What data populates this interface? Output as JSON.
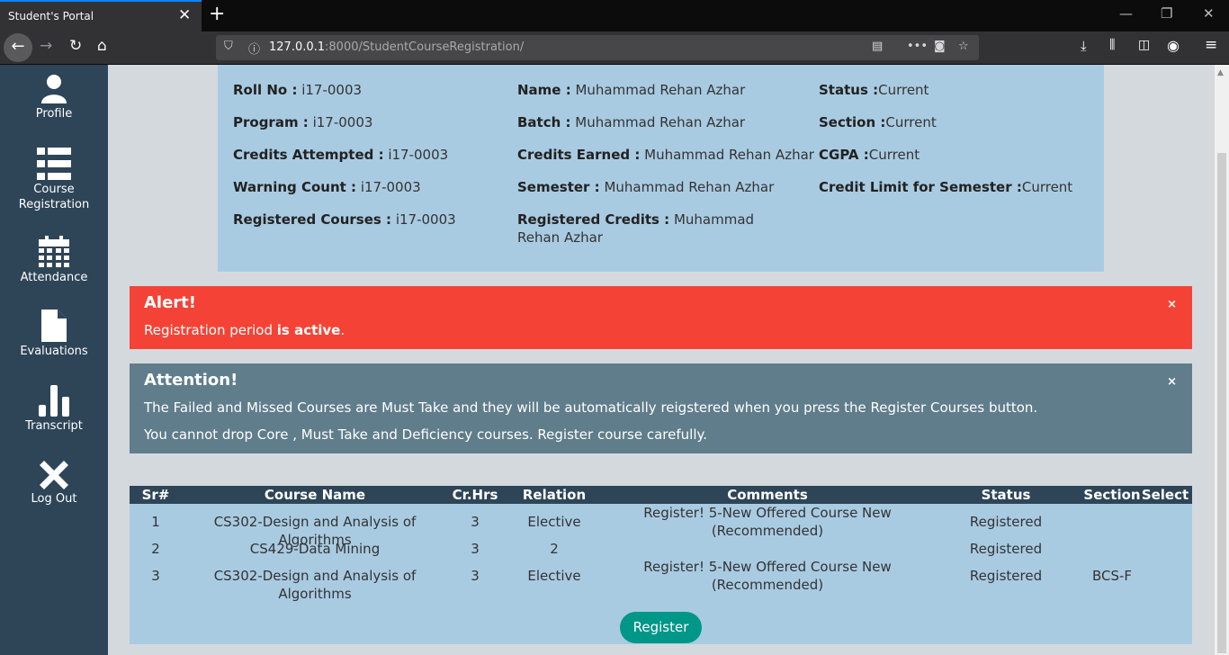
{
  "browser": {
    "tab_title": "Student's Portal",
    "url_host": "127.0.0.1",
    "url_rest": ":8000/StudentCourseRegistration/"
  },
  "sidebar": {
    "items": [
      {
        "label": "Profile"
      },
      {
        "label": "Course Registration"
      },
      {
        "label": "Attendance"
      },
      {
        "label": "Evaluations"
      },
      {
        "label": "Transcript"
      },
      {
        "label": "Log Out"
      }
    ]
  },
  "info": {
    "roll_no": {
      "label": "Roll No :",
      "value": " i17-0003"
    },
    "name": {
      "label": "Name :",
      "value": " Muhammad Rehan Azhar"
    },
    "status": {
      "label": "Status :",
      "value": "Current"
    },
    "program": {
      "label": "Program :",
      "value": " i17-0003"
    },
    "batch": {
      "label": "Batch :",
      "value": " Muhammad Rehan Azhar"
    },
    "section": {
      "label": "Section :",
      "value": "Current"
    },
    "credits_attempted": {
      "label": "Credits Attempted :",
      "value": " i17-0003"
    },
    "credits_earned": {
      "label": "Credits Earned :",
      "value": " Muhammad Rehan Azhar"
    },
    "cgpa": {
      "label": "CGPA :",
      "value": "Current"
    },
    "warning_count": {
      "label": "Warning Count :",
      "value": " i17-0003"
    },
    "semester": {
      "label": "Semester :",
      "value": " Muhammad Rehan Azhar"
    },
    "credit_limit": {
      "label": "Credit Limit for Semester :",
      "value": "Current"
    },
    "registered_courses": {
      "label": "Registered Courses :",
      "value": " i17-0003"
    },
    "registered_credits": {
      "label": "Registered Credits :",
      "value": " Muhammad Rehan Azhar"
    }
  },
  "alert": {
    "title": "Alert!",
    "text_prefix": "Registration period ",
    "text_bold": "is active",
    "text_suffix": ".",
    "close": "×"
  },
  "attention": {
    "title": "Attention!",
    "line1": "The Failed and Missed Courses are Must Take and they will be automatically reigstered when you press the Register Courses button.",
    "line2": "You cannot drop Core , Must Take and Deficiency courses. Register course carefully.",
    "close": "×"
  },
  "table": {
    "headers": {
      "sr": "Sr#",
      "course": "Course Name",
      "crhrs": "Cr.Hrs",
      "relation": "Relation",
      "comments": "Comments",
      "status": "Status",
      "section": "Section",
      "select": "Select"
    },
    "rows": [
      {
        "sr": "1",
        "course": "CS302-Design and Analysis of Algorithms",
        "crhrs": "3",
        "relation": "Elective",
        "comments1": "Register! 5-New Offered Course New",
        "comments2": "(Recommended)",
        "status": "Registered",
        "section": ""
      },
      {
        "sr": "2",
        "course": "CS429-Data Mining",
        "crhrs": "3",
        "relation": "2",
        "comments1": "",
        "comments2": "",
        "status": "Registered",
        "section": ""
      },
      {
        "sr": "3",
        "course": "CS302-Design and Analysis of Algorithms",
        "crhrs": "3",
        "relation": "Elective",
        "comments1": "Register! 5-New Offered Course New",
        "comments2": "(Recommended)",
        "status": "Registered",
        "section": "BCS-F"
      }
    ],
    "register_label": "Register"
  }
}
